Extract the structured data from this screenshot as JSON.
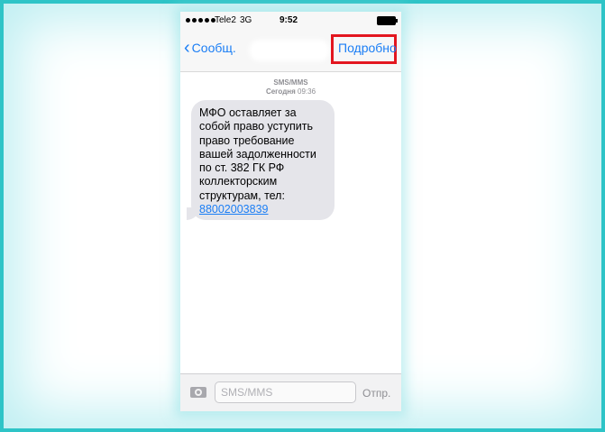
{
  "status_bar": {
    "carrier": "Tele2",
    "network": "3G",
    "time": "9:52"
  },
  "nav": {
    "back_label": "Сообщ.",
    "details_label": "Подробно"
  },
  "thread": {
    "message_type": "SMS/MMS",
    "day": "Сегодня",
    "time": "09:36",
    "message_text": "МФО оставляет за\nсобой право уступить\nправо требование\nвашей задолженности\nпо ст. 382 ГК РФ\nколлекторским\nструктурам, тел:",
    "phone_number": "88002003839"
  },
  "compose": {
    "placeholder": "SMS/MMS",
    "send_label": "Отпр."
  },
  "colors": {
    "frame": "#2ec4c7",
    "link_blue": "#1b7ef5",
    "highlight_red": "#e3161f",
    "bubble_gray": "#e5e5ea"
  }
}
